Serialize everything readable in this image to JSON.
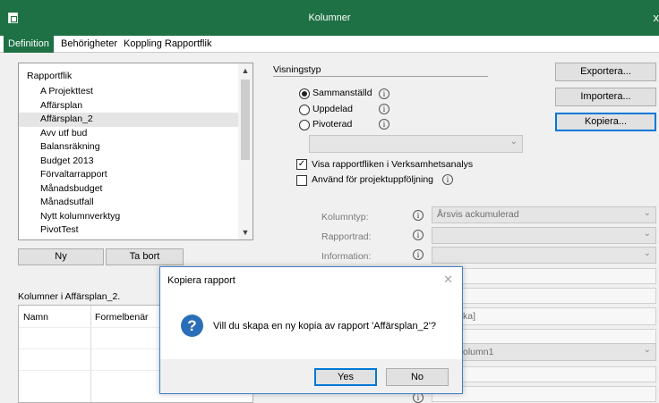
{
  "window": {
    "title": "Kolumner",
    "close_glyph": "x"
  },
  "tabs": [
    {
      "label": "Definition"
    },
    {
      "label": "Behörigheter"
    },
    {
      "label": "Koppling Rapportflik"
    }
  ],
  "report_list": {
    "header": "Rapportflik",
    "items": [
      {
        "label": "A Projekttest"
      },
      {
        "label": "Affärsplan"
      },
      {
        "label": "Affärsplan_2"
      },
      {
        "label": "Avv utf bud"
      },
      {
        "label": "Balansräkning"
      },
      {
        "label": "Budget 2013"
      },
      {
        "label": "Förvaltarrapport"
      },
      {
        "label": "Månadsbudget"
      },
      {
        "label": "Månadsutfall"
      },
      {
        "label": "Nytt kolumnverktyg"
      },
      {
        "label": "PivotTest"
      }
    ],
    "selected_index": 2
  },
  "buttons": {
    "new": "Ny",
    "delete": "Ta bort",
    "export": "Exportera...",
    "import": "Importera...",
    "copy": "Kopiera..."
  },
  "view_type": {
    "label": "Visningstyp",
    "options": [
      {
        "label": "Sammanställd",
        "checked": true
      },
      {
        "label": "Uppdelad",
        "checked": false
      },
      {
        "label": "Pivoterad",
        "checked": false
      }
    ]
  },
  "checkboxes": {
    "show_in_analysis": {
      "label": "Visa rapportfliken i Verksamhetsanalys",
      "checked": true
    },
    "use_for_project": {
      "label": "Använd för projektuppföljning",
      "checked": false
    }
  },
  "settings": {
    "column_type_label": "Kolumntyp:",
    "column_type_value": "Årsvis ackumulerad",
    "report_row_label": "Rapportrad:",
    "information_label": "Information:"
  },
  "columns_section": {
    "title": "Kolumner i Affärsplan_2.",
    "headers": [
      "Namn",
      "Formelbenär"
    ]
  },
  "partial_fields": {
    "bracket_text": "ka]",
    "column_value": "olumn1"
  },
  "dialog": {
    "title": "Kopiera rapport",
    "message": "Vill du skapa en ny kopia av rapport 'Affärsplan_2'?",
    "icon_glyph": "?",
    "yes_label": "Yes",
    "no_label": "No"
  },
  "colors": {
    "accent": "#1e7145",
    "dialog_border": "#3f82c4",
    "question_icon": "#2a6eb9",
    "focus_border": "#0078d7"
  }
}
